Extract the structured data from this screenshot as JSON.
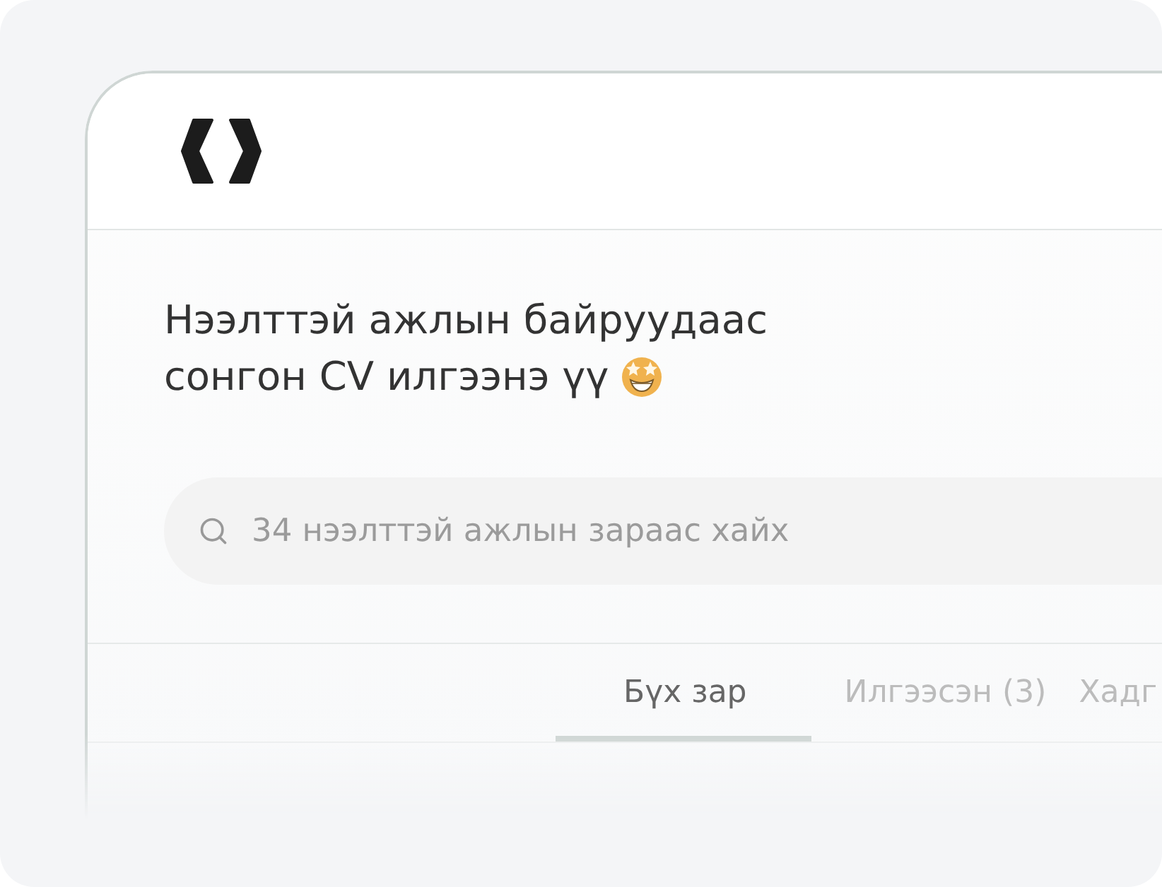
{
  "heading": {
    "lines": [
      "Нээлттэй ажлын байруудаас",
      "сонгон CV илгээнэ үү"
    ]
  },
  "search": {
    "placeholder": "34 нээлттэй ажлын зараас хайх"
  },
  "tabs": [
    {
      "label": "Бүх зар",
      "selected": true
    },
    {
      "label": "Илгээсэн (3)",
      "selected": false
    },
    {
      "label": "Хадг",
      "selected": false
    }
  ]
}
